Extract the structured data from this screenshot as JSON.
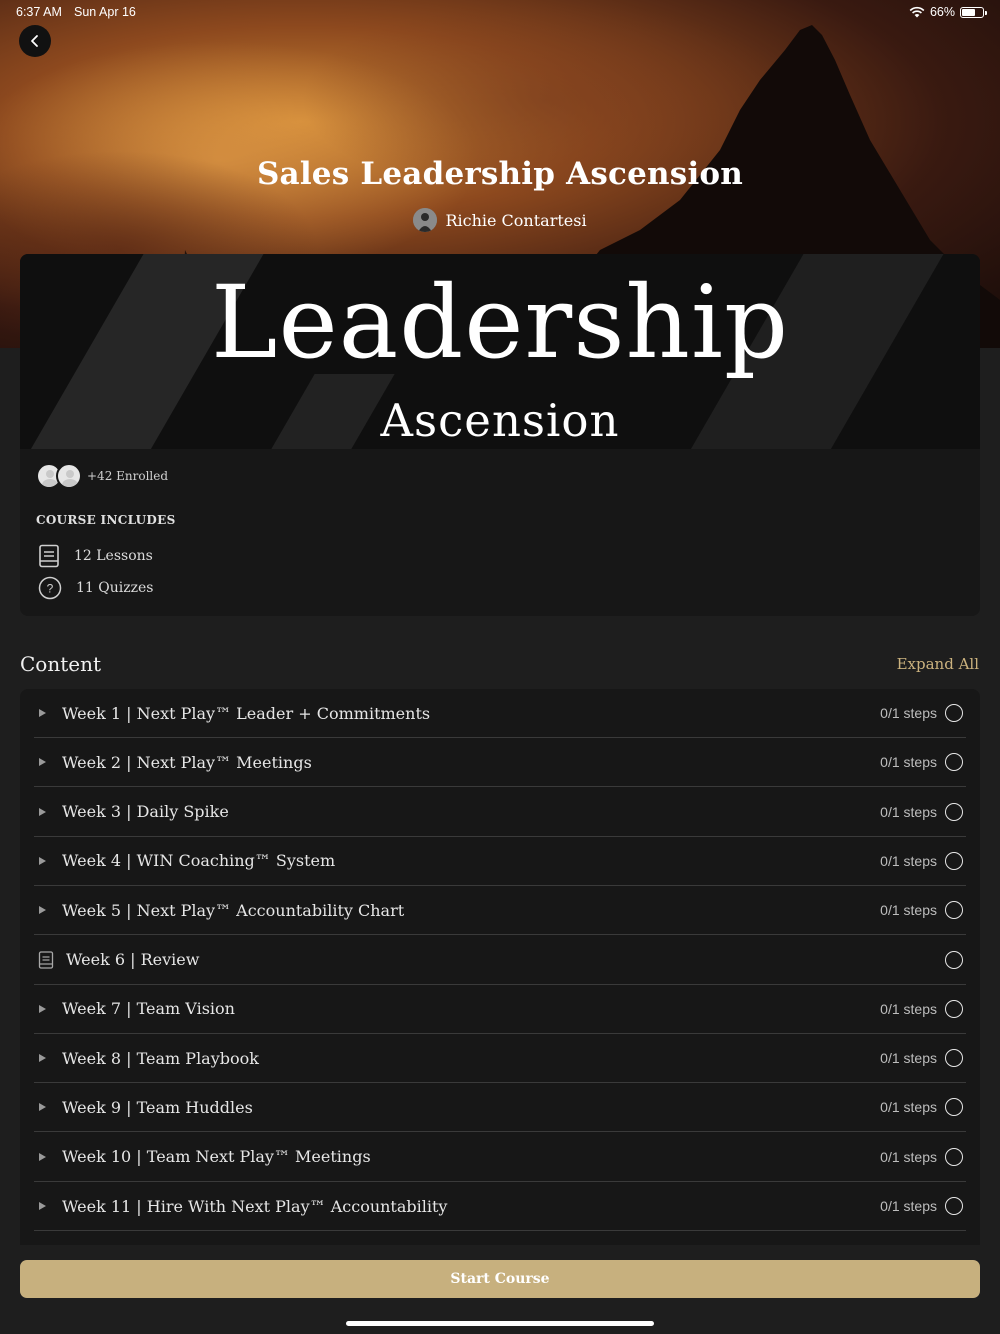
{
  "status_bar": {
    "time": "6:37 AM",
    "date": "Sun Apr 16",
    "battery_percent": "66%",
    "battery_level": 0.66
  },
  "header": {
    "back_icon": "chevron-left-icon",
    "course_title": "Sales Leadership Ascension",
    "author_name": "Richie Contartesi"
  },
  "banner": {
    "title": "Leadership",
    "subtitle": "Ascension"
  },
  "card": {
    "enrolled_label": "+42 Enrolled",
    "includes_title": "COURSE INCLUDES",
    "lessons": "12 Lessons",
    "quizzes": "11 Quizzes"
  },
  "content": {
    "title": "Content",
    "expand_all": "Expand All",
    "items": [
      {
        "title": "Week 1 | Next Play™ Leader + Commitments",
        "steps": "0/1 steps",
        "type": "topic"
      },
      {
        "title": "Week 2 | Next Play™ Meetings",
        "steps": "0/1 steps",
        "type": "topic"
      },
      {
        "title": "Week 3 | Daily Spike",
        "steps": "0/1 steps",
        "type": "topic"
      },
      {
        "title": "Week 4 | WIN Coaching™ System",
        "steps": "0/1 steps",
        "type": "topic"
      },
      {
        "title": "Week 5 | Next Play™ Accountability Chart",
        "steps": "0/1 steps",
        "type": "topic"
      },
      {
        "title": "Week 6 | Review",
        "steps": "",
        "type": "lesson"
      },
      {
        "title": "Week 7 | Team Vision",
        "steps": "0/1 steps",
        "type": "topic"
      },
      {
        "title": "Week 8 | Team Playbook",
        "steps": "0/1 steps",
        "type": "topic"
      },
      {
        "title": "Week 9 | Team Huddles",
        "steps": "0/1 steps",
        "type": "topic"
      },
      {
        "title": "Week 10 | Team Next Play™ Meetings",
        "steps": "0/1 steps",
        "type": "topic"
      },
      {
        "title": "Week 11 | Hire With Next Play™ Accountability",
        "steps": "0/1 steps",
        "type": "topic"
      }
    ]
  },
  "footer": {
    "start_button": "Start Course"
  },
  "colors": {
    "accent": "#c7b07e",
    "background": "#1e1e1e",
    "card": "#171717"
  }
}
